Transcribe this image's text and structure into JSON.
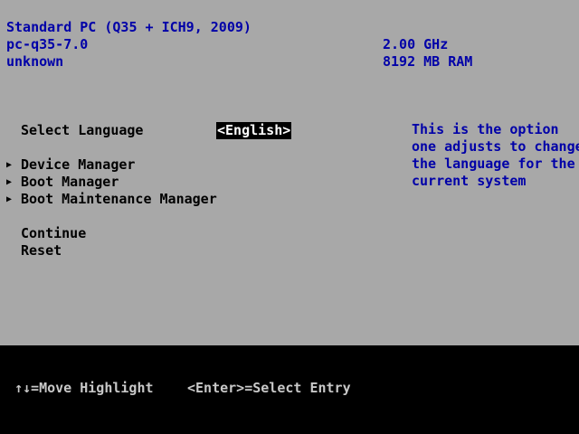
{
  "header": {
    "system_name": "Standard PC (Q35 + ICH9, 2009)",
    "machine_type": "pc-q35-7.0",
    "serial": "unknown",
    "cpu_speed": "2.00 GHz",
    "memory": "8192 MB RAM"
  },
  "menu": {
    "language_label": "Select Language",
    "language_value": "<English>",
    "device_manager": "Device Manager",
    "boot_manager": "Boot Manager",
    "boot_maintenance_manager": "Boot Maintenance Manager",
    "continue": "Continue",
    "reset": "Reset"
  },
  "help": {
    "lines": [
      "This is the option",
      "one adjusts to change",
      "the language for the",
      "current system"
    ]
  },
  "footer": {
    "move_hint": "↑↓=Move Highlight",
    "enter_hint": "<Enter>=Select Entry"
  },
  "colors": {
    "background": "#a8a8a8",
    "header_text": "#0000a8",
    "footer_bg": "#000000",
    "highlight_bg": "#000000",
    "highlight_text": "#ffffff"
  }
}
